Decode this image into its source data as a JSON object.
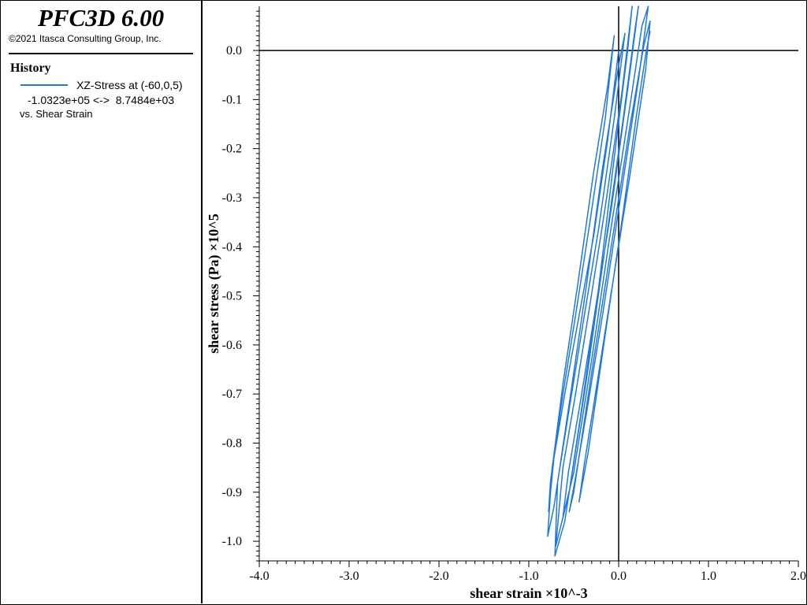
{
  "panel": {
    "app_title": "PFC3D 6.00",
    "copyright": "©2021 Itasca Consulting Group, Inc.",
    "history_heading": "History",
    "series_label": "XZ-Stress at (-60,0,5)",
    "series_range": "-1.0323e+05 <->  8.7484e+03",
    "series_vs": "vs. Shear Strain"
  },
  "colors": {
    "series": "#1f78e0",
    "axes": "#000000"
  },
  "chart_data": {
    "type": "line",
    "title": "",
    "xlabel": "shear strain ×10^-3",
    "ylabel": "shear stress (Pa) ×10^5",
    "xlim": [
      -4.0,
      2.0
    ],
    "ylim": [
      -1.04,
      0.09
    ],
    "x_ticks": [
      -4.0,
      -3.0,
      -2.0,
      -1.0,
      0.0,
      1.0,
      2.0
    ],
    "x_tick_labels": [
      "-4.0",
      "-3.0",
      "-2.0",
      "-1.0",
      "0.0",
      "1.0",
      "2.0"
    ],
    "y_ticks": [
      0.0,
      -0.1,
      -0.2,
      -0.3,
      -0.4,
      -0.5,
      -0.6,
      -0.7,
      -0.8,
      -0.9,
      -1.0
    ],
    "y_tick_labels": [
      "0.0",
      "-0.1",
      "-0.2",
      "-0.3",
      "-0.4",
      "-0.5",
      "-0.6",
      "-0.7",
      "-0.8",
      "-0.9",
      "-1.0"
    ],
    "grid": false,
    "series": [
      {
        "x": [
          0.0,
          -0.12,
          -0.28,
          -0.45,
          -0.6,
          -0.72,
          -0.78,
          -0.76,
          -0.62,
          -0.45,
          -0.28,
          -0.12,
          -0.05,
          -0.15,
          -0.32,
          -0.48,
          -0.62,
          -0.74,
          -0.79,
          -0.72,
          -0.55,
          -0.36,
          -0.18,
          0.0,
          0.07,
          -0.05,
          -0.22,
          -0.4,
          -0.55,
          -0.68,
          -0.71,
          -0.6,
          -0.42,
          -0.22,
          -0.05,
          0.1,
          0.15,
          0.04,
          -0.15,
          -0.33,
          -0.48,
          -0.62,
          -0.68,
          -0.7,
          -0.55,
          -0.35,
          -0.15,
          0.05,
          0.18,
          0.22,
          0.1,
          -0.08,
          -0.27,
          -0.43,
          -0.56,
          -0.62,
          -0.5,
          -0.3,
          -0.1,
          0.12,
          0.26,
          0.33,
          0.22,
          0.02,
          -0.18,
          -0.35,
          -0.48,
          -0.55,
          -0.5,
          -0.32,
          -0.1,
          0.12,
          0.28,
          0.35,
          0.3,
          0.12,
          -0.08,
          -0.25,
          -0.38,
          -0.44,
          -0.34,
          -0.15,
          0.05,
          0.2,
          0.3,
          0.35
        ],
        "y": [
          0.0,
          -0.18,
          -0.38,
          -0.55,
          -0.7,
          -0.83,
          -0.94,
          -0.88,
          -0.68,
          -0.47,
          -0.25,
          -0.07,
          0.03,
          -0.14,
          -0.35,
          -0.54,
          -0.7,
          -0.85,
          -0.99,
          -0.93,
          -0.72,
          -0.48,
          -0.24,
          -0.03,
          0.035,
          -0.14,
          -0.36,
          -0.56,
          -0.73,
          -0.88,
          -1.03,
          -0.96,
          -0.74,
          -0.48,
          -0.22,
          0.0,
          0.09,
          -0.08,
          -0.32,
          -0.53,
          -0.7,
          -0.85,
          -0.97,
          -1.01,
          -0.9,
          -0.66,
          -0.4,
          -0.14,
          0.04,
          0.09,
          -0.08,
          -0.32,
          -0.54,
          -0.72,
          -0.86,
          -0.95,
          -0.86,
          -0.63,
          -0.38,
          -0.12,
          0.05,
          0.09,
          -0.06,
          -0.3,
          -0.54,
          -0.73,
          -0.87,
          -0.94,
          -0.9,
          -0.68,
          -0.42,
          -0.16,
          0.01,
          0.06,
          -0.04,
          -0.26,
          -0.49,
          -0.69,
          -0.84,
          -0.92,
          -0.82,
          -0.58,
          -0.33,
          -0.13,
          -0.01,
          0.04
        ]
      }
    ]
  }
}
